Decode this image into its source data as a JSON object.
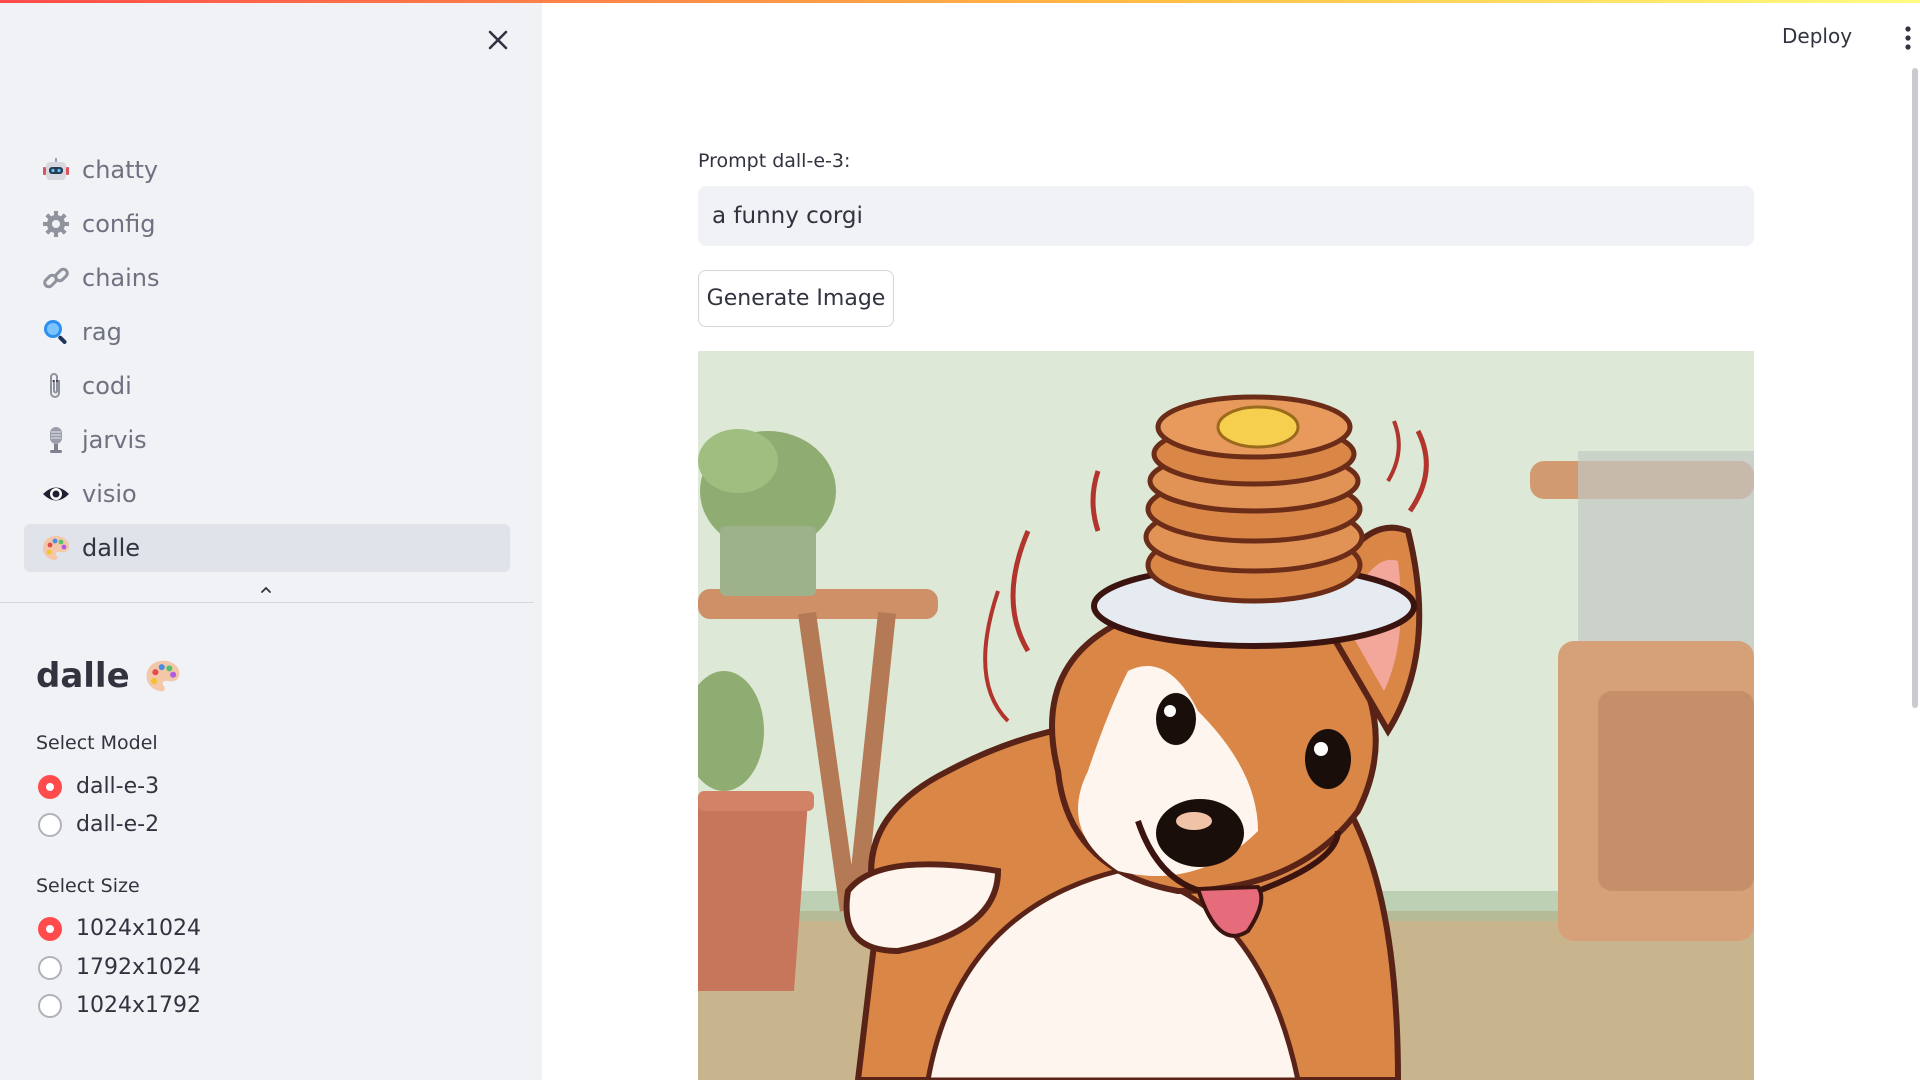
{
  "sidebar": {
    "nav": [
      {
        "label": "chatty",
        "icon": "robot-icon"
      },
      {
        "label": "config",
        "icon": "gear-icon"
      },
      {
        "label": "chains",
        "icon": "link-icon"
      },
      {
        "label": "rag",
        "icon": "magnifier-icon"
      },
      {
        "label": "codi",
        "icon": "paperclip-icon"
      },
      {
        "label": "jarvis",
        "icon": "microphone-icon"
      },
      {
        "label": "visio",
        "icon": "eye-icon"
      },
      {
        "label": "dalle",
        "icon": "palette-icon",
        "active": true
      }
    ],
    "title": "dalle",
    "model_label": "Select Model",
    "models": [
      "dall-e-3",
      "dall-e-2"
    ],
    "selected_model": "dall-e-3",
    "size_label": "Select Size",
    "sizes": [
      "1024x1024",
      "1792x1024",
      "1024x1792"
    ],
    "selected_size": "1024x1024"
  },
  "header": {
    "deploy_label": "Deploy"
  },
  "main": {
    "prompt_label": "Prompt dall-e-3:",
    "prompt_value": "a funny corgi",
    "generate_label": "Generate Image",
    "image_subject": "corgi-with-pancakes-illustration"
  },
  "colors": {
    "accent": "#ff4b4b",
    "sidebar_bg": "#f0f2f6",
    "active_bg": "#e0e3ea"
  }
}
